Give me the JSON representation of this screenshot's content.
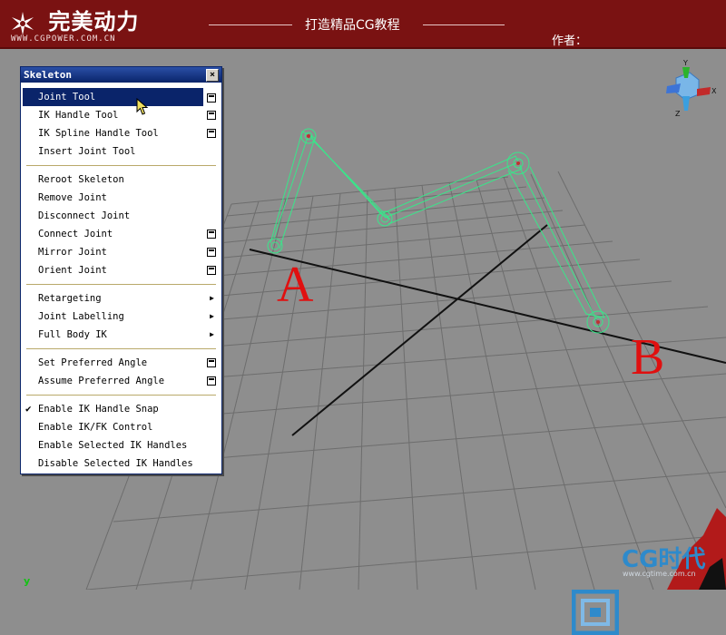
{
  "banner": {
    "brand": "完美动力",
    "url": "WWW.CGPOWER.COM.CN",
    "tagline": "打造精品CG教程",
    "author": "作者："
  },
  "menu": {
    "title": "Skeleton",
    "close": "×",
    "groups": [
      [
        {
          "label": "Joint Tool",
          "option": true,
          "highlighted": true
        },
        {
          "label": "IK Handle Tool",
          "option": true
        },
        {
          "label": "IK Spline Handle Tool",
          "option": true
        },
        {
          "label": "Insert Joint Tool",
          "option": false
        }
      ],
      [
        {
          "label": "Reroot Skeleton",
          "option": false
        },
        {
          "label": "Remove Joint",
          "option": false
        },
        {
          "label": "Disconnect Joint",
          "option": false
        },
        {
          "label": "Connect Joint",
          "option": true
        },
        {
          "label": "Mirror Joint",
          "option": true
        },
        {
          "label": "Orient Joint",
          "option": true
        }
      ],
      [
        {
          "label": "Retargeting",
          "submenu": true
        },
        {
          "label": "Joint Labelling",
          "submenu": true
        },
        {
          "label": "Full Body IK",
          "submenu": true
        }
      ],
      [
        {
          "label": "Set Preferred Angle",
          "option": true
        },
        {
          "label": "Assume Preferred Angle",
          "option": true
        }
      ],
      [
        {
          "label": "Enable IK Handle Snap",
          "checked": true
        },
        {
          "label": "Enable IK/FK Control"
        },
        {
          "label": "Enable Selected IK Handles"
        },
        {
          "label": "Disable Selected IK Handles"
        }
      ]
    ]
  },
  "scene": {
    "label_a": "A",
    "label_b": "B",
    "axis_y": "y",
    "colors": {
      "joint": "#39e68a",
      "grid": "#6d6d6d",
      "grid_bg": "#8e8e8e",
      "label": "#e01010"
    }
  },
  "watermark": {
    "brand": "CG时代",
    "url": "www.cgtime.com.cn"
  }
}
